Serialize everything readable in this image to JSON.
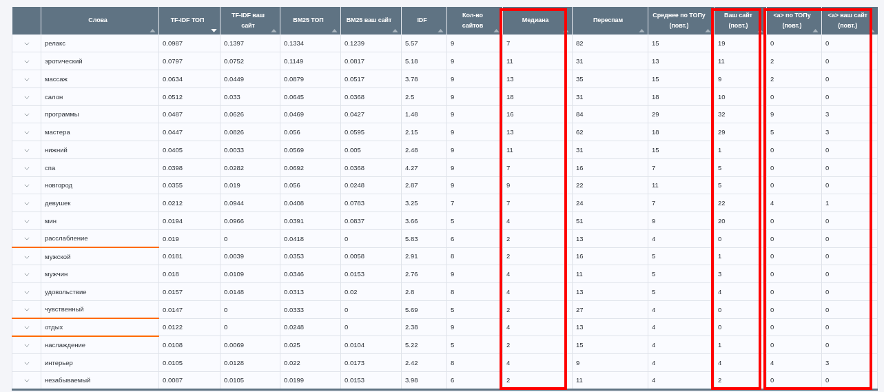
{
  "table": {
    "column_groups": [
      {
        "framed": false,
        "columns": [
          {
            "label": "Слова",
            "sorted": false
          },
          {
            "label": "TF-IDF ТОП",
            "sorted": true
          },
          {
            "label": "TF-IDF ваш сайт",
            "sorted": false
          },
          {
            "label": "BM25 ТОП",
            "sorted": false
          },
          {
            "label": "BM25 ваш сайт",
            "sorted": false
          },
          {
            "label": "IDF",
            "sorted": false
          },
          {
            "label": "Кол-во сайтов",
            "sorted": false
          }
        ]
      },
      {
        "framed": true,
        "columns": [
          {
            "label": "Медиана",
            "sorted": false
          }
        ]
      },
      {
        "framed": false,
        "columns": [
          {
            "label": "Переспам",
            "sorted": false
          },
          {
            "label": "Среднее по ТОПу (повт.)",
            "sorted": false
          }
        ]
      },
      {
        "framed": true,
        "columns": [
          {
            "label": "Ваш сайт (повт.)",
            "sorted": false
          }
        ]
      },
      {
        "framed": true,
        "columns": [
          {
            "label": "<a> по ТОПу (повт.)",
            "sorted": false
          },
          {
            "label": "<a> ваш сайт (повт.)",
            "sorted": false
          }
        ]
      }
    ],
    "rows": [
      {
        "expanded": false,
        "underlined": false,
        "cells": [
          "релакс",
          "0.0987",
          "0.1397",
          "0.1334",
          "0.1239",
          "5.57",
          "9",
          "7",
          "82",
          "15",
          "19",
          "0",
          "0"
        ]
      },
      {
        "expanded": false,
        "underlined": false,
        "cells": [
          "эротический",
          "0.0797",
          "0.0752",
          "0.1149",
          "0.0817",
          "5.18",
          "9",
          "11",
          "31",
          "13",
          "11",
          "2",
          "0"
        ]
      },
      {
        "expanded": false,
        "underlined": false,
        "cells": [
          "массаж",
          "0.0634",
          "0.0449",
          "0.0879",
          "0.0517",
          "3.78",
          "9",
          "13",
          "35",
          "15",
          "9",
          "2",
          "0"
        ]
      },
      {
        "expanded": false,
        "underlined": false,
        "cells": [
          "салон",
          "0.0512",
          "0.033",
          "0.0645",
          "0.0368",
          "2.5",
          "9",
          "18",
          "31",
          "18",
          "10",
          "0",
          "0"
        ]
      },
      {
        "expanded": false,
        "underlined": false,
        "cells": [
          "программы",
          "0.0487",
          "0.0626",
          "0.0469",
          "0.0427",
          "1.48",
          "9",
          "16",
          "84",
          "29",
          "32",
          "9",
          "3"
        ]
      },
      {
        "expanded": false,
        "underlined": false,
        "cells": [
          "мастера",
          "0.0447",
          "0.0826",
          "0.056",
          "0.0595",
          "2.15",
          "9",
          "13",
          "62",
          "18",
          "29",
          "5",
          "3"
        ]
      },
      {
        "expanded": false,
        "underlined": false,
        "cells": [
          "нижний",
          "0.0405",
          "0.0033",
          "0.0569",
          "0.005",
          "2.48",
          "9",
          "11",
          "31",
          "15",
          "1",
          "0",
          "0"
        ]
      },
      {
        "expanded": false,
        "underlined": false,
        "cells": [
          "спа",
          "0.0398",
          "0.0282",
          "0.0692",
          "0.0368",
          "4.27",
          "9",
          "7",
          "16",
          "7",
          "5",
          "0",
          "0"
        ]
      },
      {
        "expanded": false,
        "underlined": false,
        "cells": [
          "новгород",
          "0.0355",
          "0.019",
          "0.056",
          "0.0248",
          "2.87",
          "9",
          "9",
          "22",
          "11",
          "5",
          "0",
          "0"
        ]
      },
      {
        "expanded": false,
        "underlined": false,
        "cells": [
          "девушек",
          "0.0212",
          "0.0944",
          "0.0408",
          "0.0783",
          "3.25",
          "7",
          "7",
          "24",
          "7",
          "22",
          "4",
          "1"
        ]
      },
      {
        "expanded": false,
        "underlined": false,
        "cells": [
          "мин",
          "0.0194",
          "0.0966",
          "0.0391",
          "0.0837",
          "3.66",
          "5",
          "4",
          "51",
          "9",
          "20",
          "0",
          "0"
        ]
      },
      {
        "expanded": false,
        "underlined": true,
        "cells": [
          "расслабление",
          "0.019",
          "0",
          "0.0418",
          "0",
          "5.83",
          "6",
          "2",
          "13",
          "4",
          "0",
          "0",
          "0"
        ]
      },
      {
        "expanded": false,
        "underlined": false,
        "cells": [
          "мужской",
          "0.0181",
          "0.0039",
          "0.0353",
          "0.0058",
          "2.91",
          "8",
          "2",
          "16",
          "5",
          "1",
          "0",
          "0"
        ]
      },
      {
        "expanded": false,
        "underlined": false,
        "cells": [
          "мужчин",
          "0.018",
          "0.0109",
          "0.0346",
          "0.0153",
          "2.76",
          "9",
          "4",
          "11",
          "5",
          "3",
          "0",
          "0"
        ]
      },
      {
        "expanded": false,
        "underlined": false,
        "cells": [
          "удовольствие",
          "0.0157",
          "0.0148",
          "0.0313",
          "0.02",
          "2.8",
          "8",
          "4",
          "13",
          "5",
          "4",
          "0",
          "0"
        ]
      },
      {
        "expanded": false,
        "underlined": true,
        "cells": [
          "чувственный",
          "0.0147",
          "0",
          "0.0333",
          "0",
          "5.69",
          "5",
          "2",
          "27",
          "4",
          "0",
          "0",
          "0"
        ]
      },
      {
        "expanded": false,
        "underlined": true,
        "cells": [
          "отдых",
          "0.0122",
          "0",
          "0.0248",
          "0",
          "2.38",
          "9",
          "4",
          "13",
          "4",
          "0",
          "0",
          "0"
        ]
      },
      {
        "expanded": false,
        "underlined": false,
        "cells": [
          "наслаждение",
          "0.0108",
          "0.0069",
          "0.025",
          "0.0104",
          "5.22",
          "5",
          "2",
          "15",
          "4",
          "1",
          "0",
          "0"
        ]
      },
      {
        "expanded": false,
        "underlined": false,
        "cells": [
          "интерьер",
          "0.0105",
          "0.0128",
          "0.022",
          "0.0173",
          "2.42",
          "8",
          "4",
          "9",
          "4",
          "4",
          "4",
          "3"
        ]
      },
      {
        "expanded": false,
        "underlined": false,
        "cells": [
          "незабываемый",
          "0.0087",
          "0.0105",
          "0.0199",
          "0.0153",
          "3.98",
          "6",
          "2",
          "11",
          "4",
          "2",
          "0",
          "0"
        ]
      }
    ]
  }
}
